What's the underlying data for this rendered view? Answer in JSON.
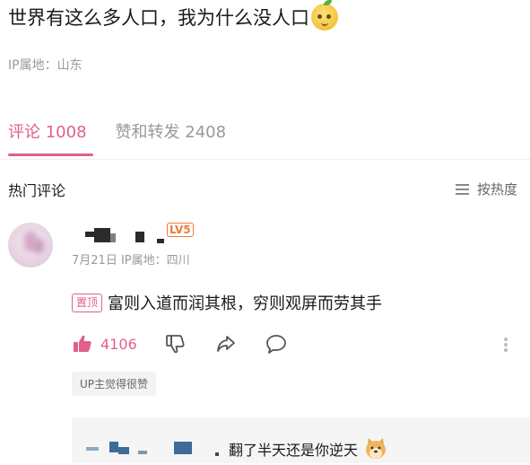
{
  "post": {
    "title": "世界有这么多人口，我为什么没人口",
    "title_emoji": "sweating-pear-emoji-icon",
    "ip_location": "IP属地：山东"
  },
  "tabs": {
    "comments": "评论 1008",
    "likes_reposts": "赞和转发 2408",
    "active_color": "#e0608a"
  },
  "section": {
    "hot_comments": "热门评论",
    "sort_label": "按热度"
  },
  "comment": {
    "level_badge": "LV5",
    "meta": "7月21日  IP属地：四川",
    "pin_label": "置顶",
    "text": "富则入道而润其根，穷则观屏而劳其手",
    "like_count": "4106",
    "up_badge": "UP主觉得很赞"
  },
  "reply": {
    "text": "翻了半天还是你逆天",
    "emoji": "doge-icon"
  }
}
